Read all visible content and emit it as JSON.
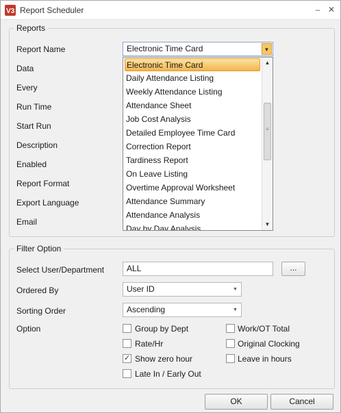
{
  "window": {
    "title": "Report Scheduler",
    "minimize": "–",
    "close": "✕",
    "app_icon": "v3-app-icon"
  },
  "reports": {
    "legend": "Reports",
    "labels": {
      "report_name": "Report Name",
      "data": "Data",
      "every": "Every",
      "run_time": "Run Time",
      "start_run": "Start Run",
      "description": "Description",
      "enabled": "Enabled",
      "report_format": "Report Format",
      "export_language": "Export Language",
      "email": "Email"
    },
    "report_name_value": "Electronic Time Card",
    "dropdown_items": [
      "Electronic Time Card",
      "Daily Attendance Listing",
      "Weekly Attendance Listing",
      "Attendance Sheet",
      "Job Cost Analysis",
      "Detailed Employee Time Card",
      "Correction Report",
      "Tardiness Report",
      "On Leave Listing",
      "Overtime Approval Worksheet",
      "Attendance Summary",
      "Attendance Analysis",
      "Day by Day Analysis"
    ]
  },
  "filter": {
    "legend": "Filter Option",
    "labels": {
      "select_user": "Select User/Department",
      "ordered_by": "Ordered By",
      "sorting_order": "Sorting Order",
      "option": "Option"
    },
    "select_user_value": "ALL",
    "browse_label": "...",
    "ordered_by_value": "User ID",
    "sorting_order_value": "Ascending",
    "options": {
      "group_by_dept": {
        "label": "Group by Dept",
        "checked": false
      },
      "rate_hr": {
        "label": "Rate/Hr",
        "checked": false
      },
      "show_zero_hour": {
        "label": "Show zero hour",
        "checked": true
      },
      "late_in_early_out": {
        "label": "Late In / Early Out",
        "checked": false
      },
      "work_ot_total": {
        "label": "Work/OT Total",
        "checked": false
      },
      "original_clocking": {
        "label": "Original Clocking",
        "checked": false
      },
      "leave_in_hours": {
        "label": "Leave in hours",
        "checked": false
      }
    }
  },
  "buttons": {
    "ok": "OK",
    "cancel": "Cancel"
  },
  "colors": {
    "selection_highlight": "#f4b54b",
    "window_bg": "#f0f0f0"
  }
}
